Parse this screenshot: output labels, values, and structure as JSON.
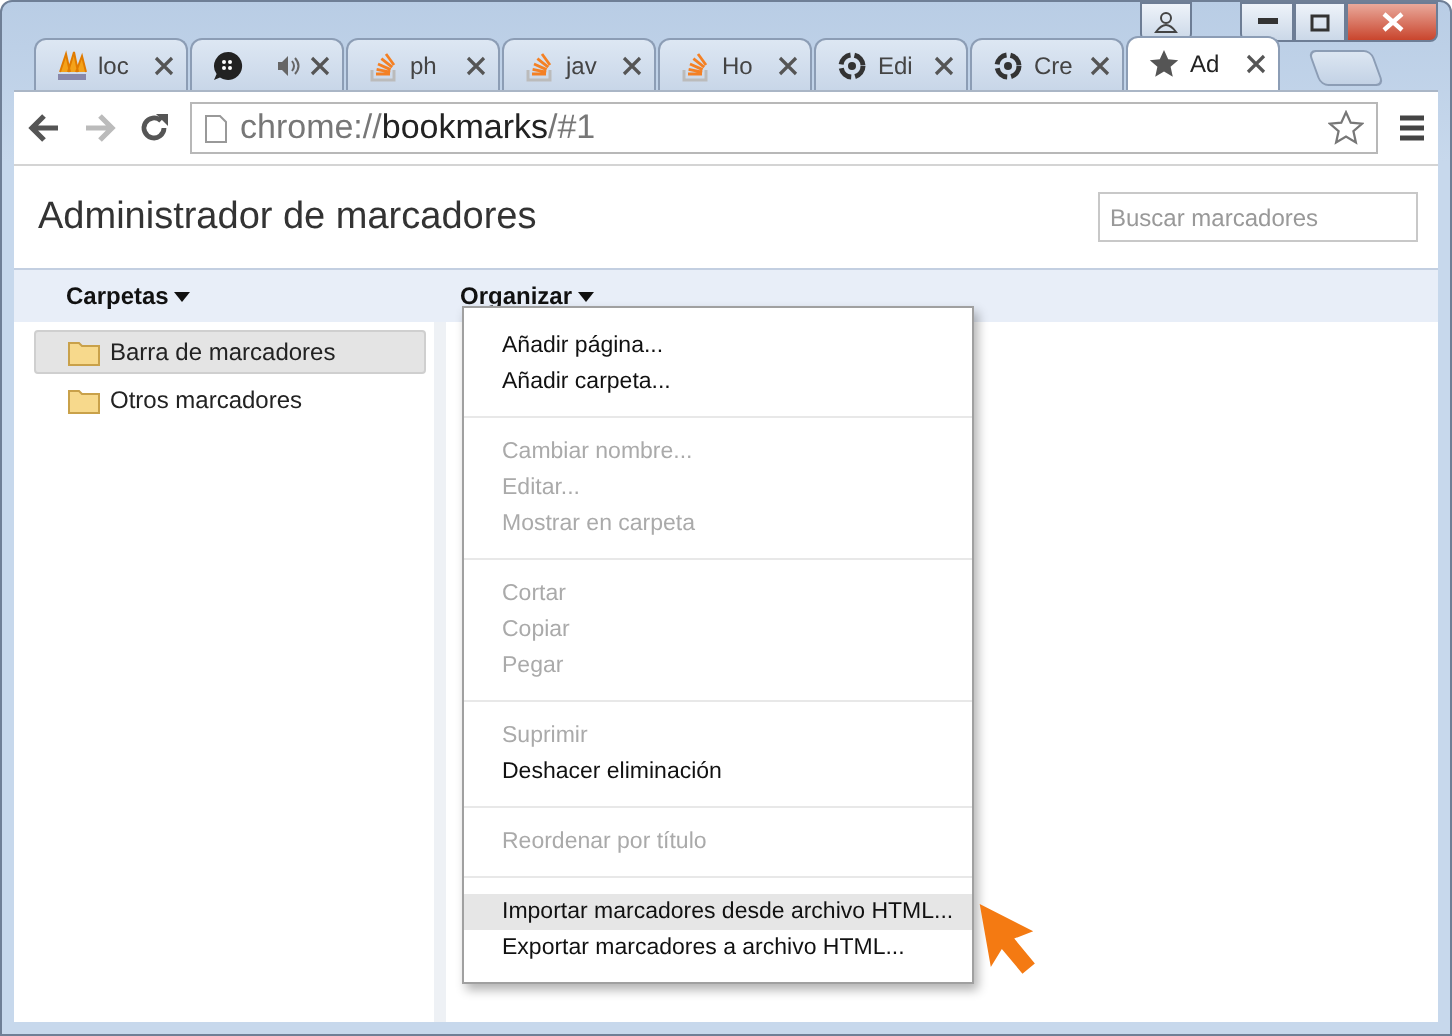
{
  "tabs": [
    {
      "title": "loc",
      "kind": "pma",
      "selected": false,
      "playing": false
    },
    {
      "kind": "chat",
      "selected": false,
      "playing": true
    },
    {
      "title": "ph",
      "kind": "stack",
      "selected": false,
      "playing": false
    },
    {
      "title": "jav",
      "kind": "stack",
      "selected": false,
      "playing": false
    },
    {
      "title": "Ho",
      "kind": "stack",
      "selected": false,
      "playing": false
    },
    {
      "title": "Edi",
      "kind": "ring",
      "selected": false,
      "playing": false
    },
    {
      "title": "Cre",
      "kind": "ring",
      "selected": false,
      "playing": false
    },
    {
      "title": "Ad",
      "kind": "star",
      "selected": true,
      "playing": false
    }
  ],
  "address": {
    "scheme": "chrome://",
    "host": "bookmarks",
    "path": "/#1"
  },
  "page": {
    "title": "Administrador de marcadores",
    "search": {
      "placeholder": "Buscar marcadores"
    }
  },
  "folders_menu": "Carpetas",
  "organize_menu": "Organizar",
  "sidebar": {
    "items": [
      {
        "label": "Barra de marcadores",
        "selected": true
      },
      {
        "label": "Otros marcadores",
        "selected": false
      }
    ]
  },
  "menu": {
    "groups": [
      [
        {
          "label": "Añadir página...",
          "disabled": false,
          "highlighted": false
        },
        {
          "label": "Añadir carpeta...",
          "disabled": false,
          "highlighted": false
        }
      ],
      [
        {
          "label": "Cambiar nombre...",
          "disabled": true,
          "highlighted": false
        },
        {
          "label": "Editar...",
          "disabled": true,
          "highlighted": false
        },
        {
          "label": "Mostrar en carpeta",
          "disabled": true,
          "highlighted": false
        }
      ],
      [
        {
          "label": "Cortar",
          "disabled": true,
          "highlighted": false
        },
        {
          "label": "Copiar",
          "disabled": true,
          "highlighted": false
        },
        {
          "label": "Pegar",
          "disabled": true,
          "highlighted": false
        }
      ],
      [
        {
          "label": "Suprimir",
          "disabled": true,
          "highlighted": false
        },
        {
          "label": "Deshacer eliminación",
          "disabled": false,
          "highlighted": false
        }
      ],
      [
        {
          "label": "Reordenar por título",
          "disabled": true,
          "highlighted": false
        }
      ],
      [
        {
          "label": "Importar marcadores desde archivo HTML...",
          "disabled": false,
          "highlighted": true
        },
        {
          "label": "Exportar marcadores a archivo HTML...",
          "disabled": false,
          "highlighted": false
        }
      ]
    ]
  }
}
